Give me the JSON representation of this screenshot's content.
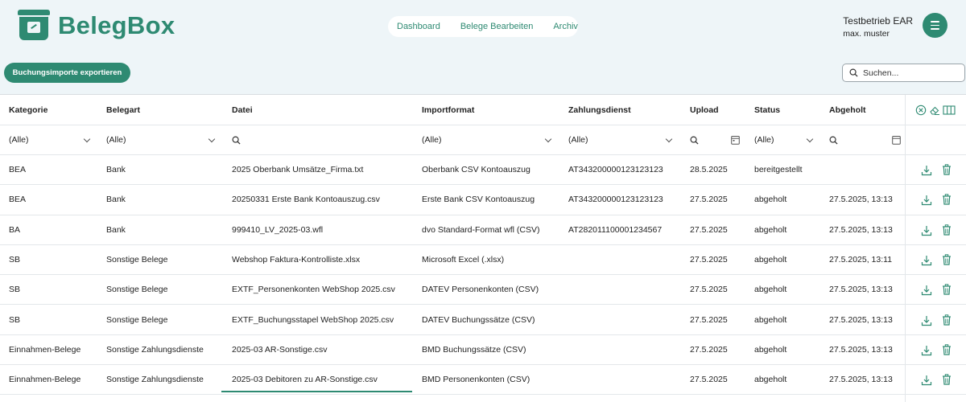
{
  "brand": {
    "name": "BelegBox"
  },
  "nav": {
    "items": [
      {
        "label": "Dashboard"
      },
      {
        "label": "Belege Bearbeiten"
      },
      {
        "label": "Archiv"
      }
    ]
  },
  "user": {
    "company": "Testbetrieb EAR",
    "name": "max. muster"
  },
  "toolbar": {
    "export_label": "Buchungsimporte exportieren"
  },
  "search": {
    "placeholder": "Suchen..."
  },
  "table": {
    "columns": [
      {
        "key": "kategorie",
        "label": "Kategorie"
      },
      {
        "key": "belegart",
        "label": "Belegart"
      },
      {
        "key": "datei",
        "label": "Datei"
      },
      {
        "key": "importformat",
        "label": "Importformat"
      },
      {
        "key": "zahlungsdienst",
        "label": "Zahlungsdienst"
      },
      {
        "key": "upload",
        "label": "Upload"
      },
      {
        "key": "status",
        "label": "Status"
      },
      {
        "key": "abgeholt",
        "label": "Abgeholt"
      }
    ],
    "filters": {
      "kategorie": "(Alle)",
      "belegart": "(Alle)",
      "importformat": "(Alle)",
      "zahlungsdienst": "(Alle)",
      "status": "(Alle)"
    },
    "rows": [
      {
        "kategorie": "BEA",
        "belegart": "Bank",
        "datei": "2025 Oberbank Umsätze_Firma.txt",
        "importformat": "Oberbank CSV Kontoauszug",
        "zahlungsdienst": "AT343200000123123123",
        "upload": "28.5.2025",
        "status": "bereitgestellt",
        "abgeholt": ""
      },
      {
        "kategorie": "BEA",
        "belegart": "Bank",
        "datei": "20250331 Erste Bank Kontoauszug.csv",
        "importformat": "Erste Bank CSV Kontoauszug",
        "zahlungsdienst": "AT343200000123123123",
        "upload": "27.5.2025",
        "status": "abgeholt",
        "abgeholt": "27.5.2025, 13:13"
      },
      {
        "kategorie": "BA",
        "belegart": "Bank",
        "datei": "999410_LV_2025-03.wfl",
        "importformat": "dvo Standard-Format wfl (CSV)",
        "zahlungsdienst": "AT282011100001234567",
        "upload": "27.5.2025",
        "status": "abgeholt",
        "abgeholt": "27.5.2025, 13:13"
      },
      {
        "kategorie": "SB",
        "belegart": "Sonstige Belege",
        "datei": "Webshop Faktura-Kontrolliste.xlsx",
        "importformat": "Microsoft Excel (.xlsx)",
        "zahlungsdienst": "",
        "upload": "27.5.2025",
        "status": "abgeholt",
        "abgeholt": "27.5.2025, 13:11"
      },
      {
        "kategorie": "SB",
        "belegart": "Sonstige Belege",
        "datei": "EXTF_Personenkonten WebShop 2025.csv",
        "importformat": "DATEV Personenkonten (CSV)",
        "zahlungsdienst": "",
        "upload": "27.5.2025",
        "status": "abgeholt",
        "abgeholt": "27.5.2025, 13:13"
      },
      {
        "kategorie": "SB",
        "belegart": "Sonstige Belege",
        "datei": "EXTF_Buchungsstapel WebShop 2025.csv",
        "importformat": "DATEV Buchungssätze (CSV)",
        "zahlungsdienst": "",
        "upload": "27.5.2025",
        "status": "abgeholt",
        "abgeholt": "27.5.2025, 13:13"
      },
      {
        "kategorie": "Einnahmen-Belege",
        "belegart": "Sonstige Zahlungsdienste",
        "datei": "2025-03 AR-Sonstige.csv",
        "importformat": "BMD Buchungssätze (CSV)",
        "zahlungsdienst": "",
        "upload": "27.5.2025",
        "status": "abgeholt",
        "abgeholt": "27.5.2025, 13:13"
      },
      {
        "kategorie": "Einnahmen-Belege",
        "belegart": "Sonstige Zahlungsdienste",
        "datei": "2025-03 Debitoren zu AR-Sonstige.csv",
        "importformat": "BMD Personenkonten (CSV)",
        "zahlungsdienst": "",
        "upload": "27.5.2025",
        "status": "abgeholt",
        "abgeholt": "27.5.2025, 13:13"
      }
    ]
  },
  "icons": {
    "header_tools": [
      "clear-filter-icon",
      "eraser-icon",
      "column-chooser-icon"
    ],
    "row_actions": [
      "download-icon",
      "delete-icon"
    ]
  },
  "colors": {
    "accent": "#2e8a72",
    "background": "#eef5f8"
  }
}
